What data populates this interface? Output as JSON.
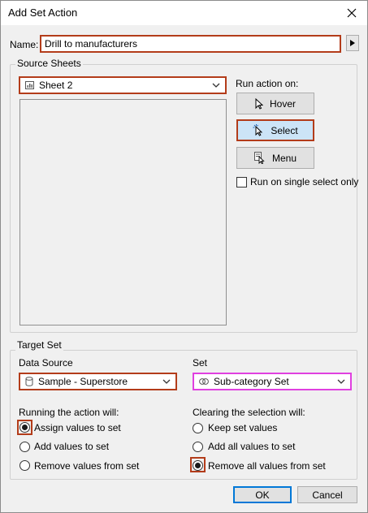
{
  "window": {
    "title": "Add Set Action",
    "close_icon": "close-icon"
  },
  "name_field": {
    "label": "Name:",
    "value": "Drill to manufacturers"
  },
  "source_sheets": {
    "group_label": "Source Sheets",
    "selected_sheet": "Sheet 2",
    "run_action_label": "Run action on:",
    "buttons": {
      "hover": "Hover",
      "select": "Select",
      "menu": "Menu"
    },
    "selected_trigger": "Select",
    "single_select_label": "Run on single select only",
    "single_select_checked": false
  },
  "target_set": {
    "group_label": "Target Set",
    "data_source_label": "Data Source",
    "data_source_value": "Sample - Superstore",
    "set_label": "Set",
    "set_value": "Sub-category Set"
  },
  "running": {
    "label": "Running the action will:",
    "options": [
      "Assign values to set",
      "Add values to set",
      "Remove values from set"
    ],
    "selected": "Assign values to set"
  },
  "clearing": {
    "label": "Clearing the selection will:",
    "options": [
      "Keep set values",
      "Add all values to set",
      "Remove all values from set"
    ],
    "selected": "Remove all values from set"
  },
  "footer": {
    "ok": "OK",
    "cancel": "Cancel"
  },
  "colors": {
    "highlight": "#b33c1a",
    "set_highlight": "#e040e0",
    "select_fill": "#cce4f7",
    "ok_border": "#0078d7"
  }
}
